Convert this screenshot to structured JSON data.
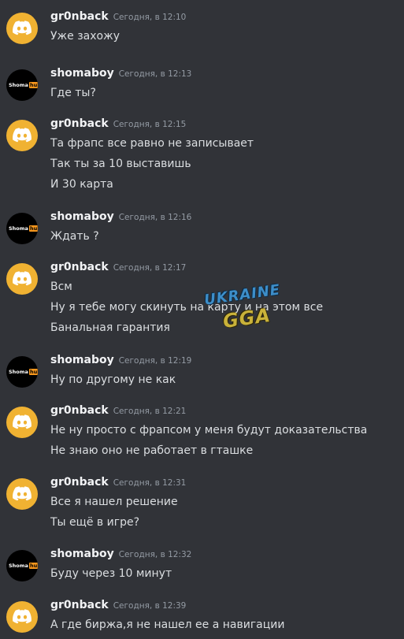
{
  "messages": [
    {
      "user": "gr0nback",
      "avatar": "discord",
      "time": "Сегодня, в 12:10",
      "lines": [
        "Уже захожу"
      ]
    },
    {
      "user": "shomaboy",
      "avatar": "shoma",
      "time": "Сегодня, в 12:13",
      "lines": [
        "Где ты?"
      ]
    },
    {
      "user": "gr0nback",
      "avatar": "discord",
      "time": "Сегодня, в 12:15",
      "lines": [
        "Та фрапс все равно не записывает",
        "Так ты за 10 выставишь",
        "И 30 карта"
      ]
    },
    {
      "user": "shomaboy",
      "avatar": "shoma",
      "time": "Сегодня, в 12:16",
      "lines": [
        "Ждать ?"
      ]
    },
    {
      "user": "gr0nback",
      "avatar": "discord",
      "time": "Сегодня, в 12:17",
      "lines": [
        "Всм",
        "Ну я тебе могу скинуть на карту и на этом все",
        "Банальная гарантия"
      ]
    },
    {
      "user": "shomaboy",
      "avatar": "shoma",
      "time": "Сегодня, в 12:19",
      "lines": [
        "Ну по другому не как"
      ]
    },
    {
      "user": "gr0nback",
      "avatar": "discord",
      "time": "Сегодня, в 12:21",
      "lines": [
        "Не ну просто с фрапсом у меня будут доказательства",
        "Не знаю оно не работает в гташке"
      ]
    },
    {
      "user": "gr0nback",
      "avatar": "discord",
      "time": "Сегодня, в 12:31",
      "lines": [
        "Все я нашел решение",
        "Ты ещё в игре?"
      ]
    },
    {
      "user": "shomaboy",
      "avatar": "shoma",
      "time": "Сегодня, в 12:32",
      "lines": [
        "Буду через 10 минут"
      ]
    },
    {
      "user": "gr0nback",
      "avatar": "discord",
      "time": "Сегодня, в 12:39",
      "lines": [
        "А где биржа,я не нашел ее а навигации"
      ]
    }
  ],
  "avatar_logo": {
    "shoma": "Shoma",
    "hub": "hub"
  },
  "watermark": {
    "line1": "UKRAINE",
    "line2": "GGA"
  },
  "colors": {
    "background": "#313338",
    "discord_avatar": "#f0b232",
    "username": "#f2f3f5",
    "timestamp": "#949ba4",
    "text": "#dbdee1"
  }
}
